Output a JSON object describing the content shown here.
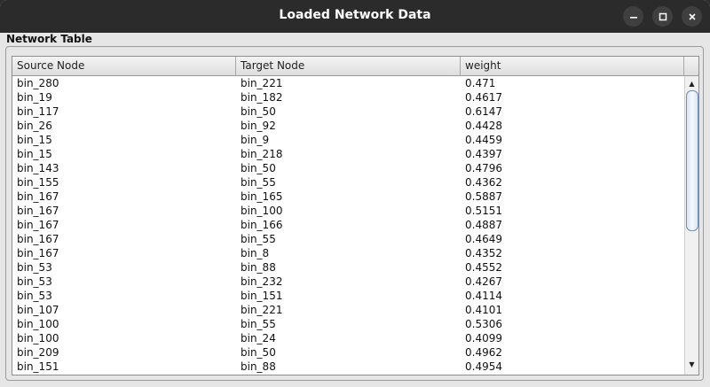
{
  "window": {
    "title": "Loaded Network Data"
  },
  "panel": {
    "title": "Network Table"
  },
  "table": {
    "headers": [
      "Source Node",
      "Target Node",
      "weight"
    ],
    "rows": [
      [
        "bin_280",
        "bin_221",
        "0.471"
      ],
      [
        "bin_19",
        "bin_182",
        "0.4617"
      ],
      [
        "bin_117",
        "bin_50",
        "0.6147"
      ],
      [
        "bin_26",
        "bin_92",
        "0.4428"
      ],
      [
        "bin_15",
        "bin_9",
        "0.4459"
      ],
      [
        "bin_15",
        "bin_218",
        "0.4397"
      ],
      [
        "bin_143",
        "bin_50",
        "0.4796"
      ],
      [
        "bin_155",
        "bin_55",
        "0.4362"
      ],
      [
        "bin_167",
        "bin_165",
        "0.5887"
      ],
      [
        "bin_167",
        "bin_100",
        "0.5151"
      ],
      [
        "bin_167",
        "bin_166",
        "0.4887"
      ],
      [
        "bin_167",
        "bin_55",
        "0.4649"
      ],
      [
        "bin_167",
        "bin_8",
        "0.4352"
      ],
      [
        "bin_53",
        "bin_88",
        "0.4552"
      ],
      [
        "bin_53",
        "bin_232",
        "0.4267"
      ],
      [
        "bin_53",
        "bin_151",
        "0.4114"
      ],
      [
        "bin_107",
        "bin_221",
        "0.4101"
      ],
      [
        "bin_100",
        "bin_55",
        "0.5306"
      ],
      [
        "bin_100",
        "bin_24",
        "0.4099"
      ],
      [
        "bin_209",
        "bin_50",
        "0.4962"
      ],
      [
        "bin_151",
        "bin_88",
        "0.4954"
      ]
    ]
  },
  "icons": {
    "minimize": "minimize-icon",
    "maximize": "maximize-icon",
    "close": "close-icon",
    "scroll_up": "scroll-up-arrow-icon",
    "scroll_down": "scroll-down-arrow-icon"
  },
  "colors": {
    "titlebar": "#2b2b2b",
    "window_bg": "#e6e6e6",
    "scroll_thumb_border": "#6f8fb3"
  }
}
